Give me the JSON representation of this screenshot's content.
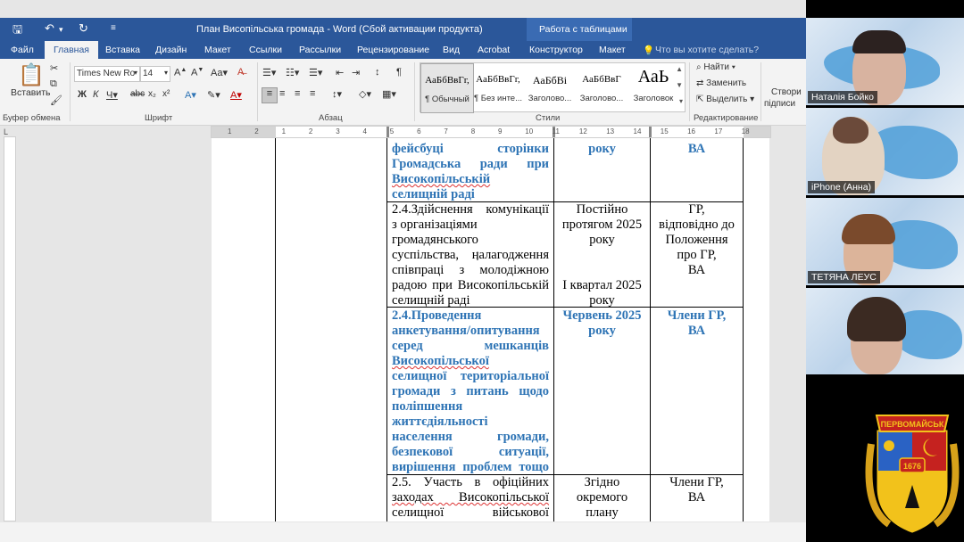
{
  "window": {
    "title": "План Висопільська громада - Word (Сбой активации продукта)",
    "context_tab_group": "Работа с таблицами"
  },
  "tabs": [
    "Файл",
    "Главная",
    "Вставка",
    "Дизайн",
    "Макет",
    "Ссылки",
    "Рассылки",
    "Рецензирование",
    "Вид",
    "Acrobat",
    "Конструктор",
    "Макет"
  ],
  "tell_me": "Что вы хотите сделать?",
  "ribbon": {
    "paste_label": "Вставить",
    "clipboard_label": "Буфер обмена",
    "font_name": "Times New Ro",
    "font_size": "14",
    "font_label": "Шрифт",
    "paragraph_label": "Абзац",
    "styles_label": "Стили",
    "editing_label": "Редактирование",
    "find_label": "Найти",
    "replace_label": "Заменить",
    "select_label": "Выделить",
    "create_label_1": "Створи",
    "create_label_2": "підписи",
    "styles": [
      {
        "preview": "АаБбВвГг,",
        "name": "¶ Обычный"
      },
      {
        "preview": "АаБбВвГг,",
        "name": "¶ Без инте..."
      },
      {
        "preview": "АаБбВі",
        "name": "Заголово..."
      },
      {
        "preview": "АаБбВвГ",
        "name": "Заголово..."
      },
      {
        "preview": "АаЬ",
        "name": "Заголовок"
      }
    ]
  },
  "ruler": {
    "ticks": [
      "1",
      "2",
      "1",
      "2",
      "3",
      "4",
      "5",
      "6",
      "7",
      "8",
      "9",
      "10",
      "11",
      "12",
      "13",
      "14",
      "15",
      "16",
      "17",
      "18"
    ]
  },
  "table": {
    "row1": {
      "c1": [
        "фейсбуці сторінки",
        "Громадська ради при",
        "Високопільській",
        "селищній раді"
      ],
      "c2": [
        "року"
      ],
      "c3": [
        "ВА"
      ]
    },
    "row2": {
      "c1": [
        "2.4.Здійснення комунікації",
        "з організаціями",
        "громадянського",
        "суспільства, налагодження",
        "співпраці з молодіжною",
        "радою при Високопільській",
        "селищній раді"
      ],
      "c2a": [
        "Постійно",
        "протягом 2025",
        "року"
      ],
      "c2b": [
        "І квартал 2025",
        "року"
      ],
      "c3": [
        "ГР,",
        "відповідно до",
        "Положення",
        "про ГР,",
        "ВА"
      ]
    },
    "row3": {
      "c1": [
        "2.4.Проведення",
        "анкетування/опитування",
        "серед мешканців",
        "Високопільської",
        "селищної територіальної",
        "громади з питань щодо",
        "поліпшення",
        "життєдіяльності",
        "населення громади,",
        "безпекової ситуації,",
        "вирішення проблем тощо"
      ],
      "c2": [
        "Червень 2025",
        "року"
      ],
      "c3": [
        "Члени ГР,",
        "ВА"
      ]
    },
    "row4": {
      "c1": [
        "2.5. Участь в офіційних",
        "заходах Високопільської",
        "селищної військової"
      ],
      "c2": [
        "Згідно",
        "окремого",
        "плану"
      ],
      "c3": [
        "Члени ГР,",
        "ВА"
      ]
    }
  },
  "participants": [
    "Наталія Бойко",
    "iPhone (Анна)",
    "ТЕТЯНА ЛЕУС",
    ""
  ],
  "emblem": {
    "text": "ПЕРВОМАЙСЬК",
    "year": "1676"
  }
}
